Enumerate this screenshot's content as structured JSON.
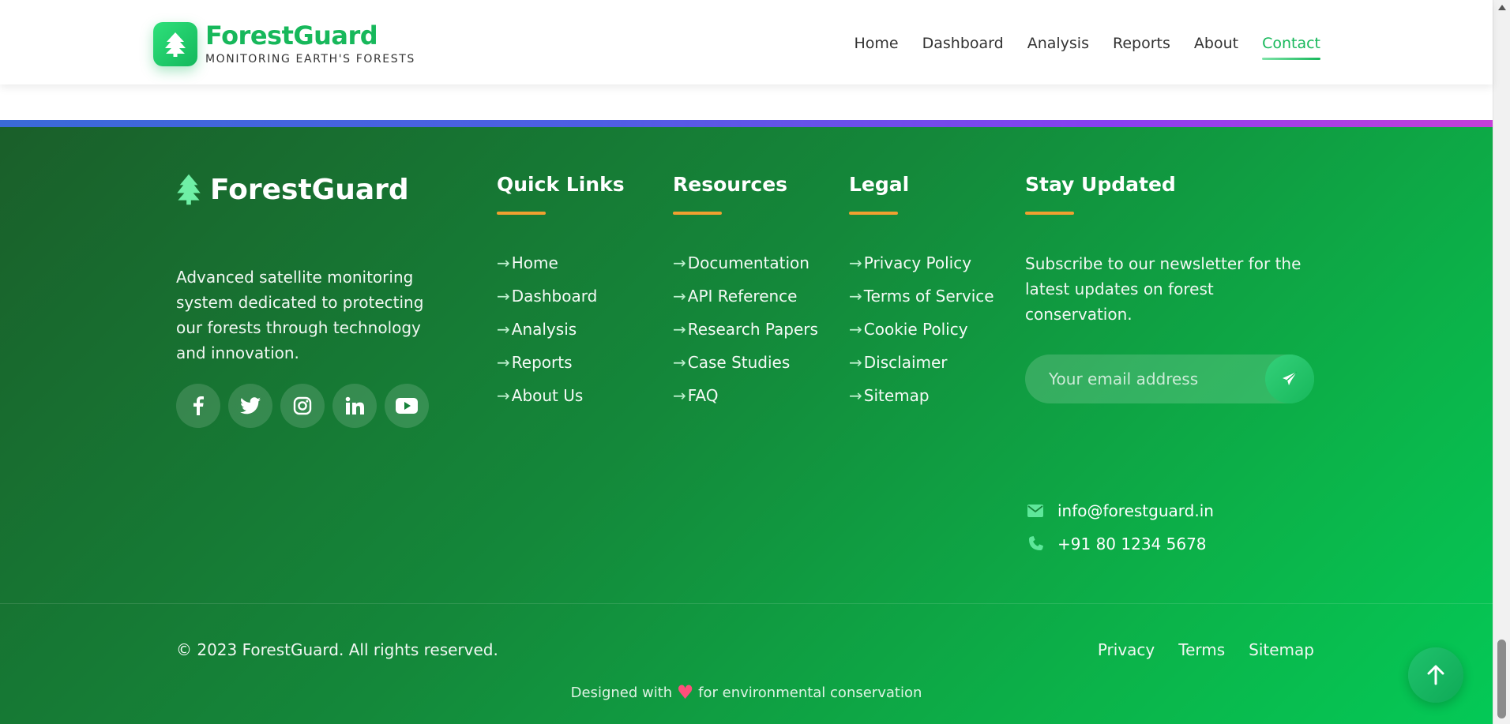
{
  "header": {
    "brand_name": "ForestGuard",
    "brand_tagline": "MONITORING EARTH'S FORESTS",
    "nav": [
      {
        "label": "Home"
      },
      {
        "label": "Dashboard"
      },
      {
        "label": "Analysis"
      },
      {
        "label": "Reports"
      },
      {
        "label": "About"
      },
      {
        "label": "Contact",
        "active": true
      }
    ]
  },
  "footer": {
    "brand_name": "ForestGuard",
    "description": "Advanced satellite monitoring system dedicated to protecting our forests through technology and innovation.",
    "socials": [
      "facebook-icon",
      "twitter-icon",
      "instagram-icon",
      "linkedin-icon",
      "youtube-icon"
    ],
    "quick_links": {
      "title": "Quick Links",
      "items": [
        "Home",
        "Dashboard",
        "Analysis",
        "Reports",
        "About Us"
      ]
    },
    "resources": {
      "title": "Resources",
      "items": [
        "Documentation",
        "API Reference",
        "Research Papers",
        "Case Studies",
        "FAQ"
      ]
    },
    "legal": {
      "title": "Legal",
      "items": [
        "Privacy Policy",
        "Terms of Service",
        "Cookie Policy",
        "Disclaimer",
        "Sitemap"
      ]
    },
    "stay_updated": {
      "title": "Stay Updated",
      "text": "Subscribe to our newsletter for the latest updates on forest conservation.",
      "email_placeholder": "Your email address"
    },
    "contact": {
      "email": "info@forestguard.in",
      "phone": "+91 80 1234 5678"
    },
    "copyright": "© 2023 ForestGuard. All rights reserved.",
    "bottom_links": [
      "Privacy",
      "Terms",
      "Sitemap"
    ],
    "designed_prefix": "Designed with",
    "designed_suffix": "for environmental conservation"
  },
  "colors": {
    "brand_green": "#17b85b",
    "footer_dark": "#1a5f2a",
    "footer_light": "#04c956",
    "underline_orange": "#f0a030",
    "heart": "#ff4f7b"
  }
}
